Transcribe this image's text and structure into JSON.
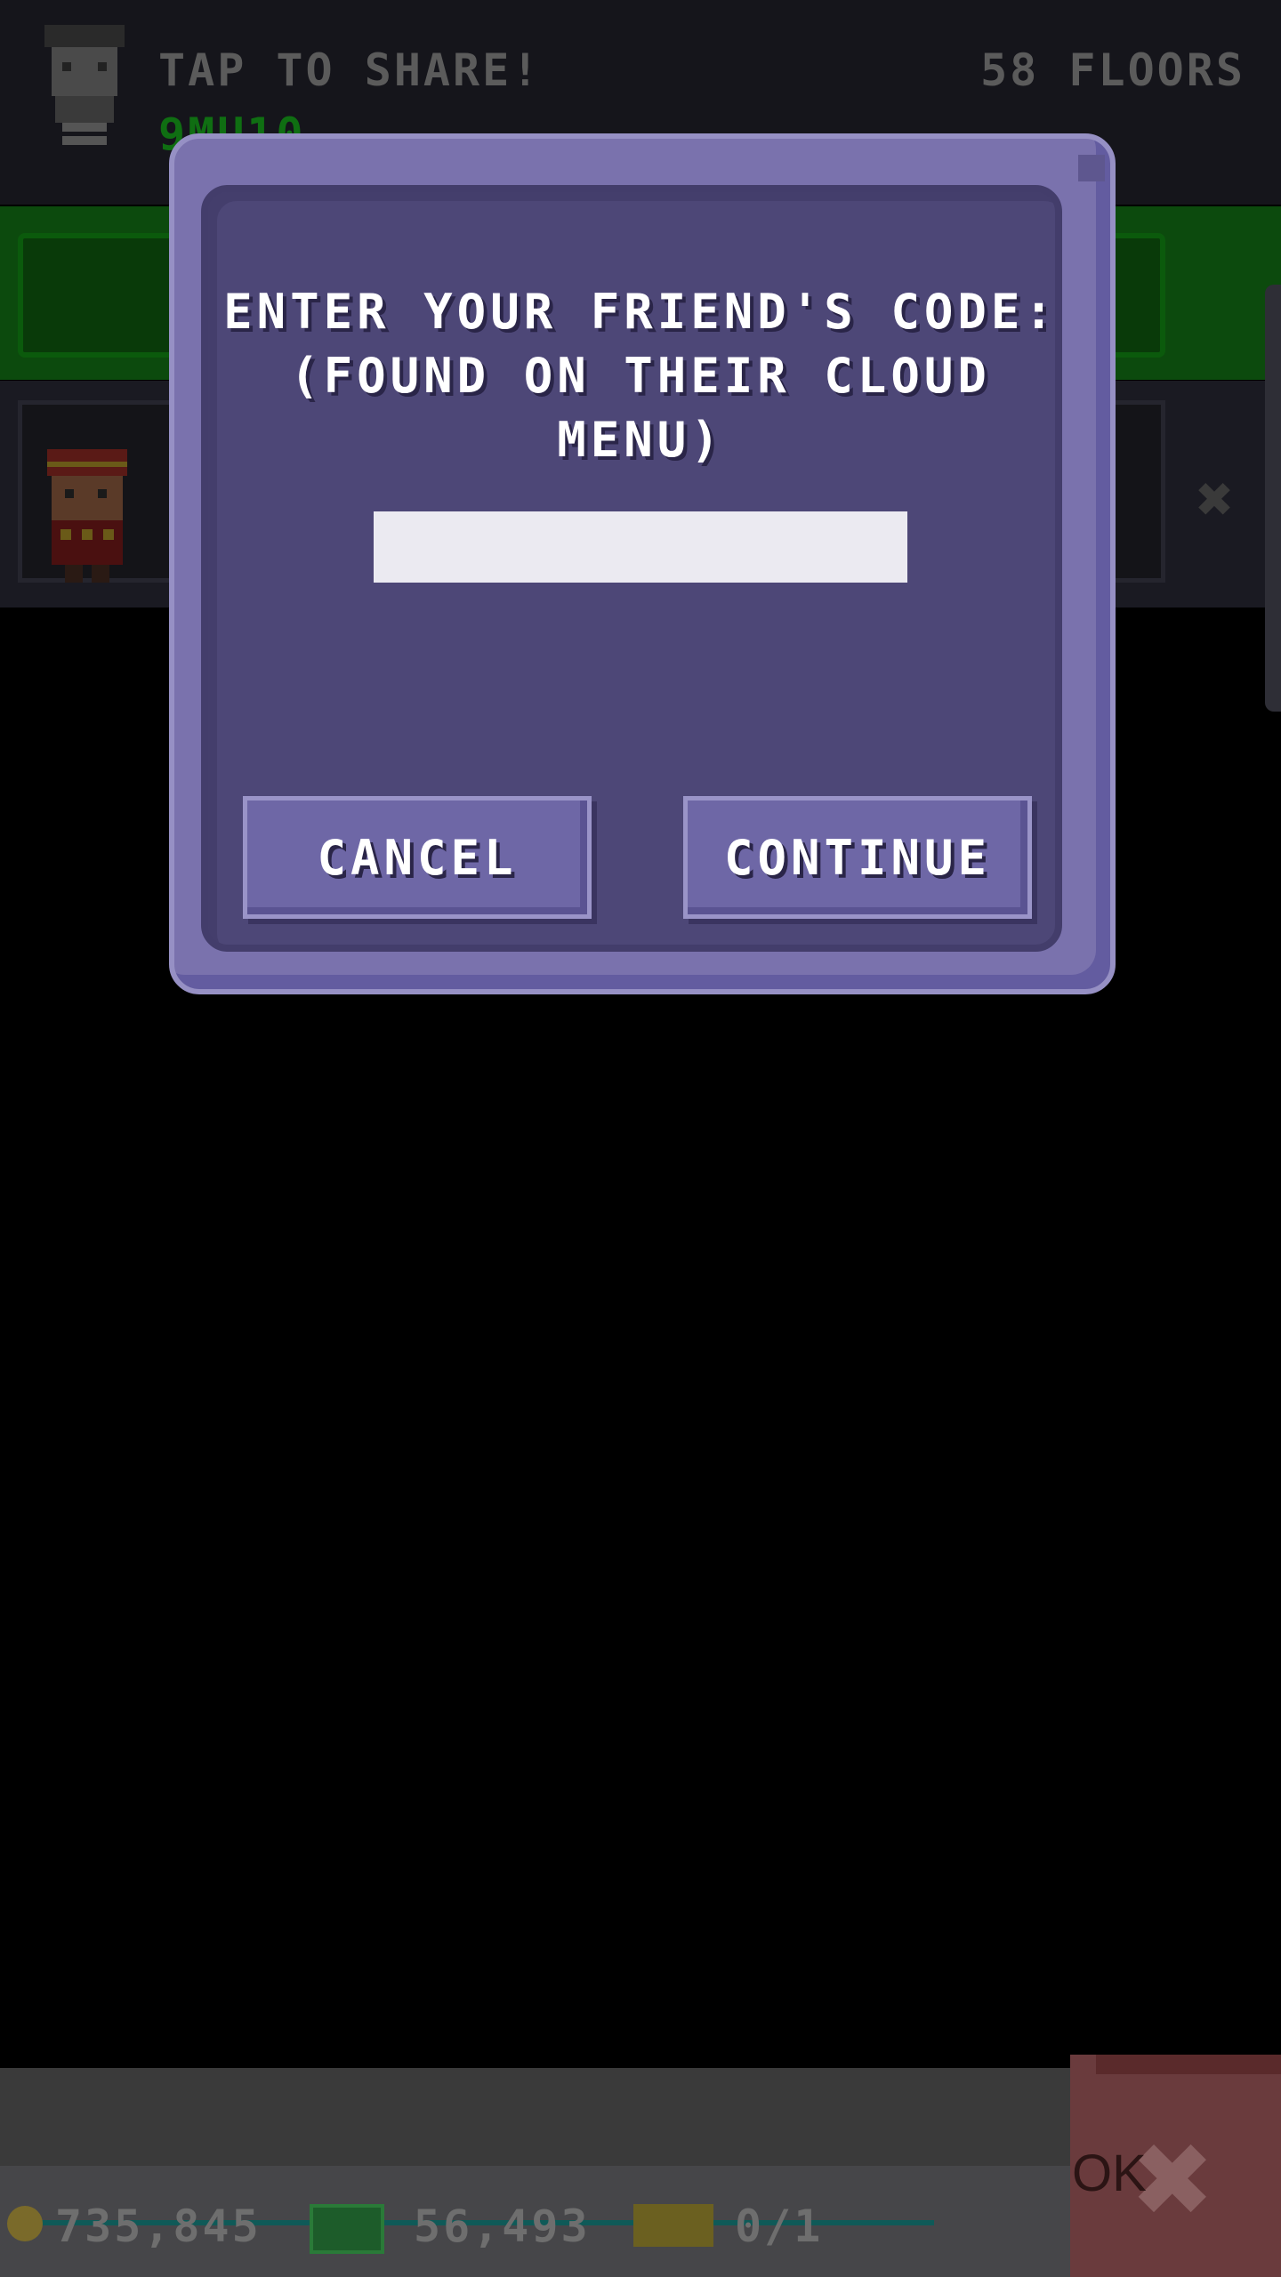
{
  "background": {
    "share_text": "TAP TO SHARE!",
    "code_text": "9MU10",
    "floors_text": "58 FLOORS"
  },
  "bottom_bar": {
    "coins": "735,845",
    "gems": "56,493",
    "tickets": "0/1",
    "ok_label": "OK"
  },
  "dialog": {
    "title_line1": "ENTER YOUR FRIEND'S CODE:",
    "title_line2": "(FOUND ON THEIR CLOUD",
    "title_line3": "MENU)",
    "code_value": "",
    "cancel_label": "CANCEL",
    "continue_label": "CONTINUE"
  },
  "colors": {
    "dialog_border": "#7a72ad",
    "dialog_fill": "#4d4777",
    "button": "#6e67a6",
    "input": "#ebeaf1"
  }
}
